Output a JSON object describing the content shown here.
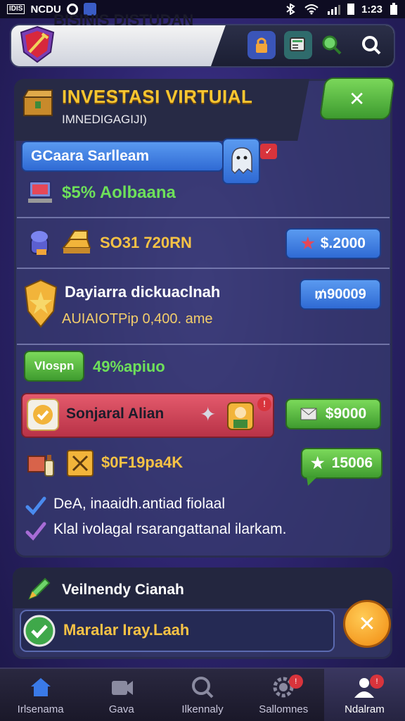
{
  "status_bar": {
    "left_label": "NCDU",
    "left_box": "IDIS",
    "time": "1:23"
  },
  "header": {
    "title": "BISINIS DISTUDAN"
  },
  "panel": {
    "title": "INVESTASI VIRTUIAL",
    "subtitle": "IMNEDIGAGIJI)"
  },
  "rows": {
    "name_pill": "GCaara Sarlleam",
    "stat_percent": "$5% Aolbaana",
    "gold_amount": "SO31 720RN",
    "gold_price": "$.2000",
    "shield_title": "Dayiarra dickuaclnah",
    "shield_sub": "AUIAIOTPip 0,400. ame",
    "shield_price": "₥90009",
    "vio_pill": "Vlospn",
    "vio_value": "49%apiuo",
    "pink_label": "Sonjaral Alian",
    "pink_price": "$9000",
    "gift_value": "$0F19pa4K",
    "star_price": "15006",
    "check_line_1": "DeA, inaaidh.antiad fiolaal",
    "check_line_2": "Klal ivolagal rsarangattanal ilarkam."
  },
  "section2": {
    "title": "Veilnendy Cianah",
    "field": "Maralar Iray.Laah"
  },
  "nav": [
    {
      "label": "Irlsenama"
    },
    {
      "label": "Gava"
    },
    {
      "label": "Ilkennaly"
    },
    {
      "label": "Sallomnes"
    },
    {
      "label": "Ndalram"
    }
  ],
  "colors": {
    "accent_gold": "#f7c631",
    "accent_green": "#6ee05a",
    "blue": "#2f6ad4",
    "pink": "#b83247"
  }
}
